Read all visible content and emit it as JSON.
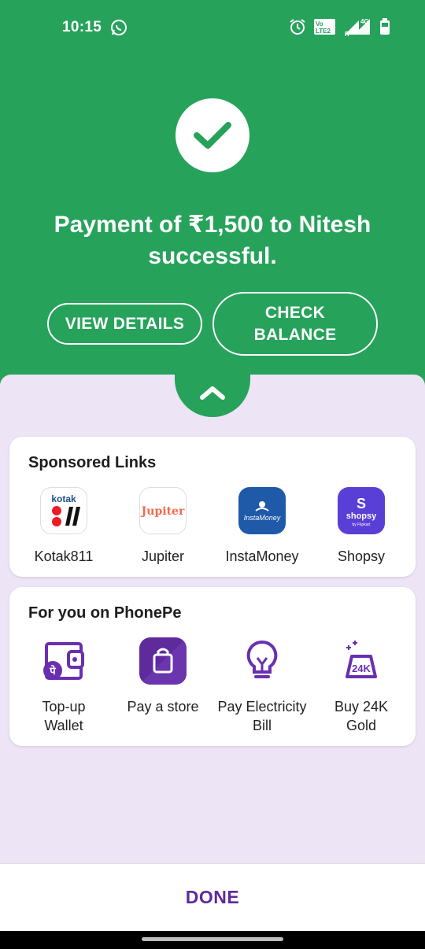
{
  "status_bar": {
    "time": "10:15",
    "volte": "Vo LTE2",
    "network": "4G",
    "roaming": "R"
  },
  "result": {
    "message": "Payment of ₹1,500 to Nitesh successful.",
    "view_details": "VIEW DETAILS",
    "check_balance": "CHECK BALANCE"
  },
  "sponsored": {
    "title": "Sponsored Links",
    "items": [
      {
        "label": "Kotak811",
        "icon": "kotak-logo"
      },
      {
        "label": "Jupiter",
        "icon": "jupiter-logo"
      },
      {
        "label": "InstaMoney",
        "icon": "instamoney-logo"
      },
      {
        "label": "Shopsy",
        "icon": "shopsy-logo"
      }
    ],
    "logos": {
      "kotak": "kotak",
      "jupiter": "Jupiter",
      "instamoney": "InstaMoney",
      "shopsy_s": "S",
      "shopsy": "shopsy",
      "shopsy_sub": "by Flipkart"
    }
  },
  "for_you": {
    "title": "For you on PhonePe",
    "items": [
      {
        "label": "Top-up Wallet",
        "icon": "wallet-icon"
      },
      {
        "label": "Pay a store",
        "icon": "shopping-bag-icon"
      },
      {
        "label": "Pay Electricity Bill",
        "icon": "bulb-icon"
      },
      {
        "label": "Buy 24K Gold",
        "icon": "gold-bar-icon"
      }
    ],
    "gold_text": "24K",
    "wallet_glyph": "पे"
  },
  "footer": {
    "done": "DONE"
  },
  "colors": {
    "green": "#26a25b",
    "purple": "#5f2a9c",
    "lavender": "#ede4f6"
  }
}
